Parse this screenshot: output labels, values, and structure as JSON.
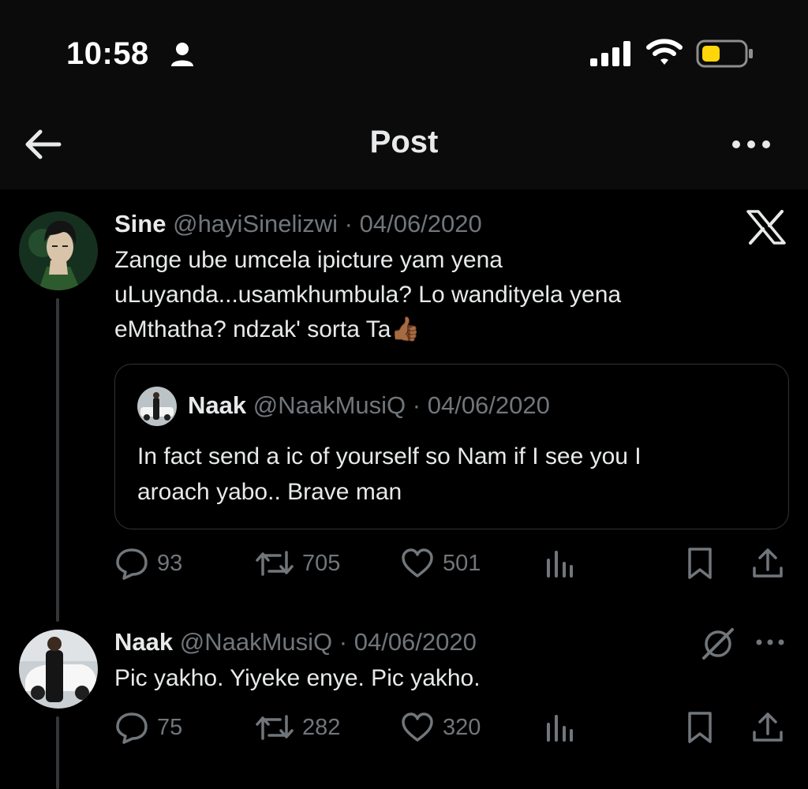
{
  "status_bar": {
    "time": "10:58",
    "icons": [
      "person-icon",
      "cellular-signal-icon",
      "wifi-icon",
      "battery-icon"
    ],
    "battery_color": "#ffd60a"
  },
  "header": {
    "title": "Post",
    "back_icon": "arrow-left-icon",
    "more_icon": "more-horizontal-icon"
  },
  "main_post": {
    "name": "Sine",
    "handle": "@hayiSinelizwi",
    "separator": "·",
    "date": "04/06/2020",
    "text_lines": [
      "Zange ube umcela ipicture yam yena",
      "uLuyanda...usamkhumbula? Lo wandityela yena",
      "eMthatha?  ndzak' sorta Ta"
    ],
    "emoji": "👍🏾",
    "quote": {
      "name": "Naak",
      "handle": "@NaakMusiQ",
      "separator": "·",
      "date": "04/06/2020",
      "text_lines": [
        "In fact send a ic of yourself so Nam if I see you I",
        "aroach yabo.. Brave man"
      ]
    },
    "stats": {
      "replies": "93",
      "reposts": "705",
      "likes": "501"
    }
  },
  "reply_post": {
    "name": "Naak",
    "handle": "@NaakMusiQ",
    "separator": "·",
    "date": "04/06/2020",
    "text": "Pic yakho. Yiyeke enye. Pic yakho.",
    "stats": {
      "replies": "75",
      "reposts": "282",
      "likes": "320"
    }
  },
  "colors": {
    "background": "#000000",
    "text_primary": "#e7e9ea",
    "text_secondary": "#71767b",
    "border": "#2f3336"
  }
}
